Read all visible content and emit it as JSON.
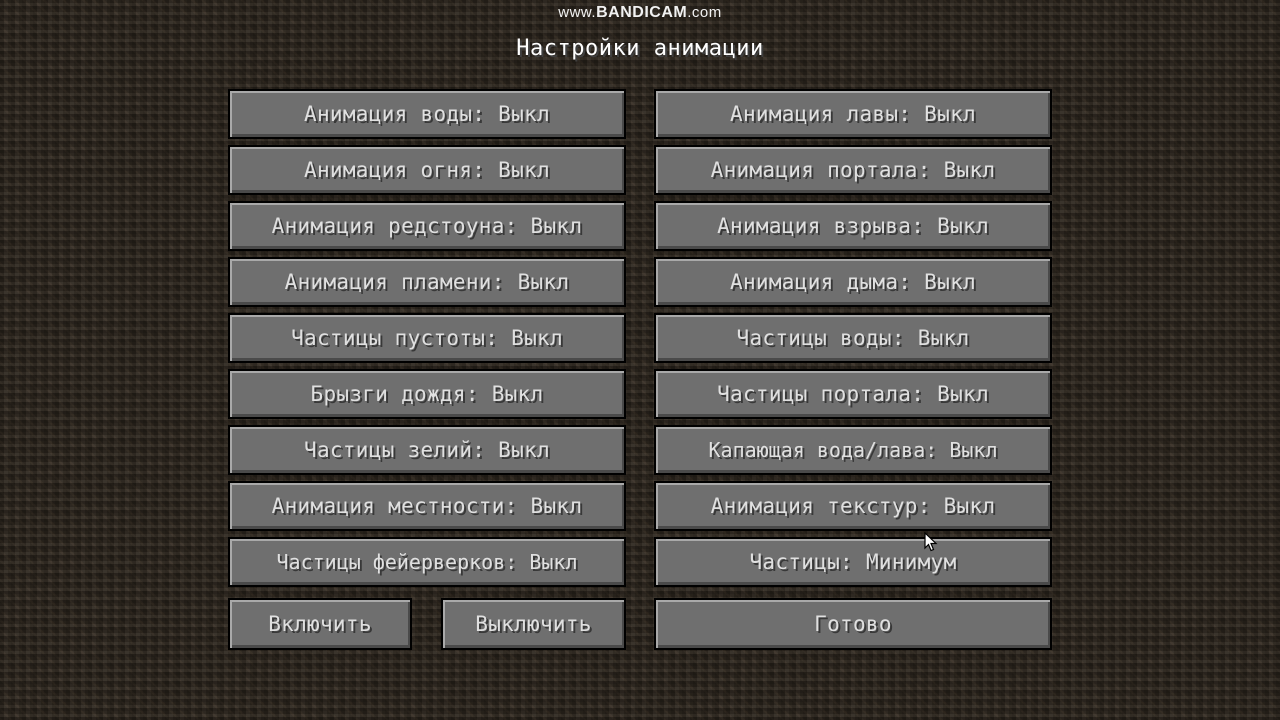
{
  "watermark": {
    "prefix": "www.",
    "brand": "BANDICAM",
    "suffix": ".com"
  },
  "screen": {
    "title": "Настройки анимации"
  },
  "left_column": [
    "Анимация воды: Выкл",
    "Анимация огня: Выкл",
    "Анимация редстоуна: Выкл",
    "Анимация пламени: Выкл",
    "Частицы пустоты: Выкл",
    "Брызги дождя: Выкл",
    "Частицы зелий: Выкл",
    "Анимация местности: Выкл",
    "Частицы фейерверков: Выкл"
  ],
  "right_column": [
    "Анимация лавы: Выкл",
    "Анимация портала: Выкл",
    "Анимация взрыва: Выкл",
    "Анимация дыма: Выкл",
    "Частицы воды: Выкл",
    "Частицы портала: Выкл",
    "Капающая вода/лава: Выкл",
    "Анимация текстур: Выкл",
    "Частицы: Минимум"
  ],
  "footer": {
    "enable_all": "Включить",
    "disable_all": "Выключить",
    "done": "Готово"
  },
  "colors": {
    "button_face": "#6f6f6f",
    "button_text": "#e0e0e0",
    "title_text": "#ffffff",
    "background": "#2f2820"
  }
}
